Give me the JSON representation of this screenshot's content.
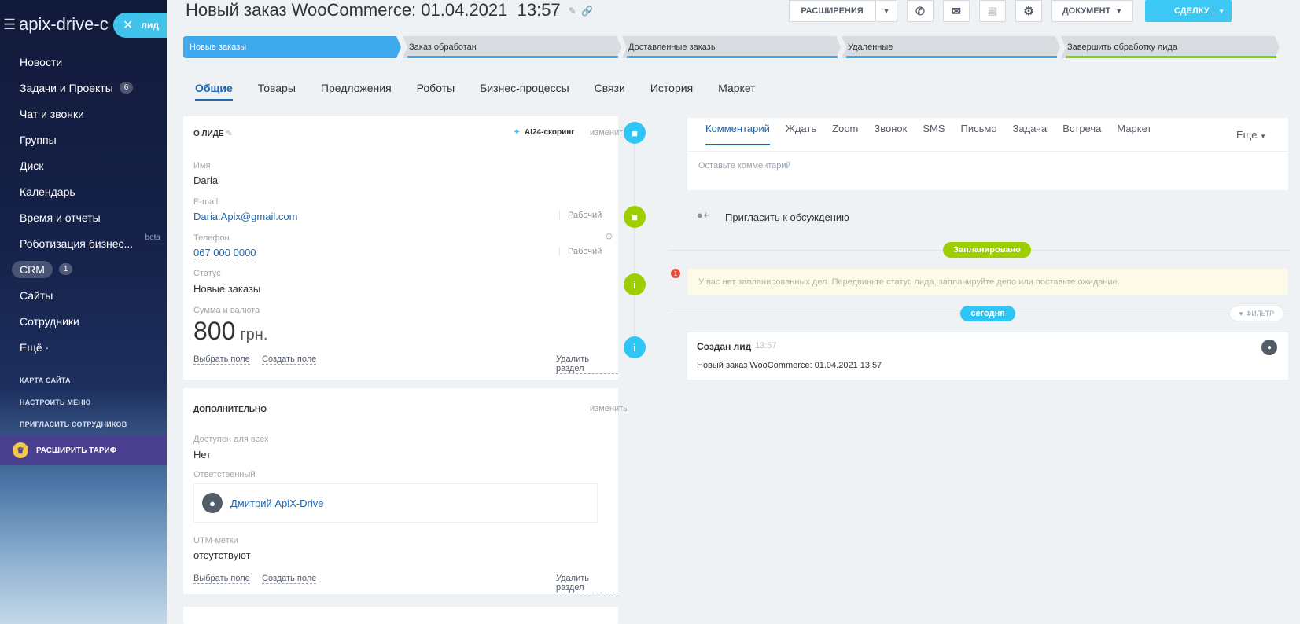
{
  "sidebar": {
    "brand": "apix-drive-c",
    "lead_tab": "лид",
    "items": [
      {
        "label": "Новости"
      },
      {
        "label": "Задачи и Проекты",
        "count": "6"
      },
      {
        "label": "Чат и звонки"
      },
      {
        "label": "Группы"
      },
      {
        "label": "Диск"
      },
      {
        "label": "Календарь"
      },
      {
        "label": "Время и отчеты"
      },
      {
        "label": "Роботизация бизнес...",
        "badge": "beta"
      },
      {
        "label": "CRM",
        "count": "1"
      },
      {
        "label": "Сайты"
      },
      {
        "label": "Сотрудники"
      },
      {
        "label": "Ещё ·"
      }
    ],
    "links": [
      "Карта сайта",
      "Настроить меню",
      "Пригласить сотрудников"
    ],
    "upgrade": "Расширить тариф"
  },
  "header": {
    "title": "Новый заказ WooCommerce: 01.04.2021  13:57",
    "extensions_btn": "РАСШИРЕНИЯ",
    "document_btn": "ДОКУМЕНТ",
    "deal_btn": "СДЕЛКУ"
  },
  "stages": [
    {
      "label": "Новые заказы",
      "active": true,
      "color": "#3fa9ee"
    },
    {
      "label": "Заказ обработан",
      "color": "#3fa9ee"
    },
    {
      "label": "Доставленные заказы",
      "color": "#3fa9ee"
    },
    {
      "label": "Удаленные",
      "color": "#3fa9ee"
    },
    {
      "label": "Завершить обработку лида",
      "color": "#7bd500"
    }
  ],
  "tabs": [
    "Общие",
    "Товары",
    "Предложения",
    "Роботы",
    "Бизнес-процессы",
    "Связи",
    "История",
    "Маркет"
  ],
  "about": {
    "title": "О лиде",
    "ai_scoring": "AI24-скоринг",
    "edit": "изменить",
    "name_label": "Имя",
    "name": "Daria",
    "email_label": "E-mail",
    "email": "Daria.Apix@gmail.com",
    "email_type": "Рабочий",
    "phone_label": "Телефон",
    "phone": "067 000 0000",
    "phone_type": "Рабочий",
    "status_label": "Статус",
    "status": "Новые заказы",
    "sum_label": "Сумма и валюта",
    "sum": "800",
    "currency": "грн.",
    "select_field": "Выбрать поле",
    "create_field": "Создать поле",
    "delete_section": "Удалить раздел"
  },
  "extra": {
    "title": "Дополнительно",
    "edit": "изменить",
    "available_label": "Доступен для всех",
    "available": "Нет",
    "responsible_label": "Ответственный",
    "responsible": "Дмитрий ApiX-Drive",
    "utm_label": "UTM-метки",
    "utm": "отсутствуют",
    "select_field": "Выбрать поле",
    "create_field": "Создать поле",
    "delete_section": "Удалить раздел"
  },
  "timeline": {
    "tabs": [
      "Комментарий",
      "Ждать",
      "Zoom",
      "Звонок",
      "SMS",
      "Письмо",
      "Задача",
      "Встреча",
      "Маркет"
    ],
    "more": "Еще",
    "comment_placeholder": "Оставьте комментарий",
    "invite": "Пригласить к обсуждению",
    "planned": "Запланировано",
    "no_tasks": "У вас нет запланированных дел. Передвиньте статус лида, запланируйте дело или поставьте ожидание.",
    "no_tasks_badge": "1",
    "today": "сегодня",
    "filter": "ФИЛЬТР",
    "created_title": "Создан лид",
    "created_time": "13:57",
    "created_text": "Новый заказ WooCommerce: 01.04.2021 13:57"
  }
}
